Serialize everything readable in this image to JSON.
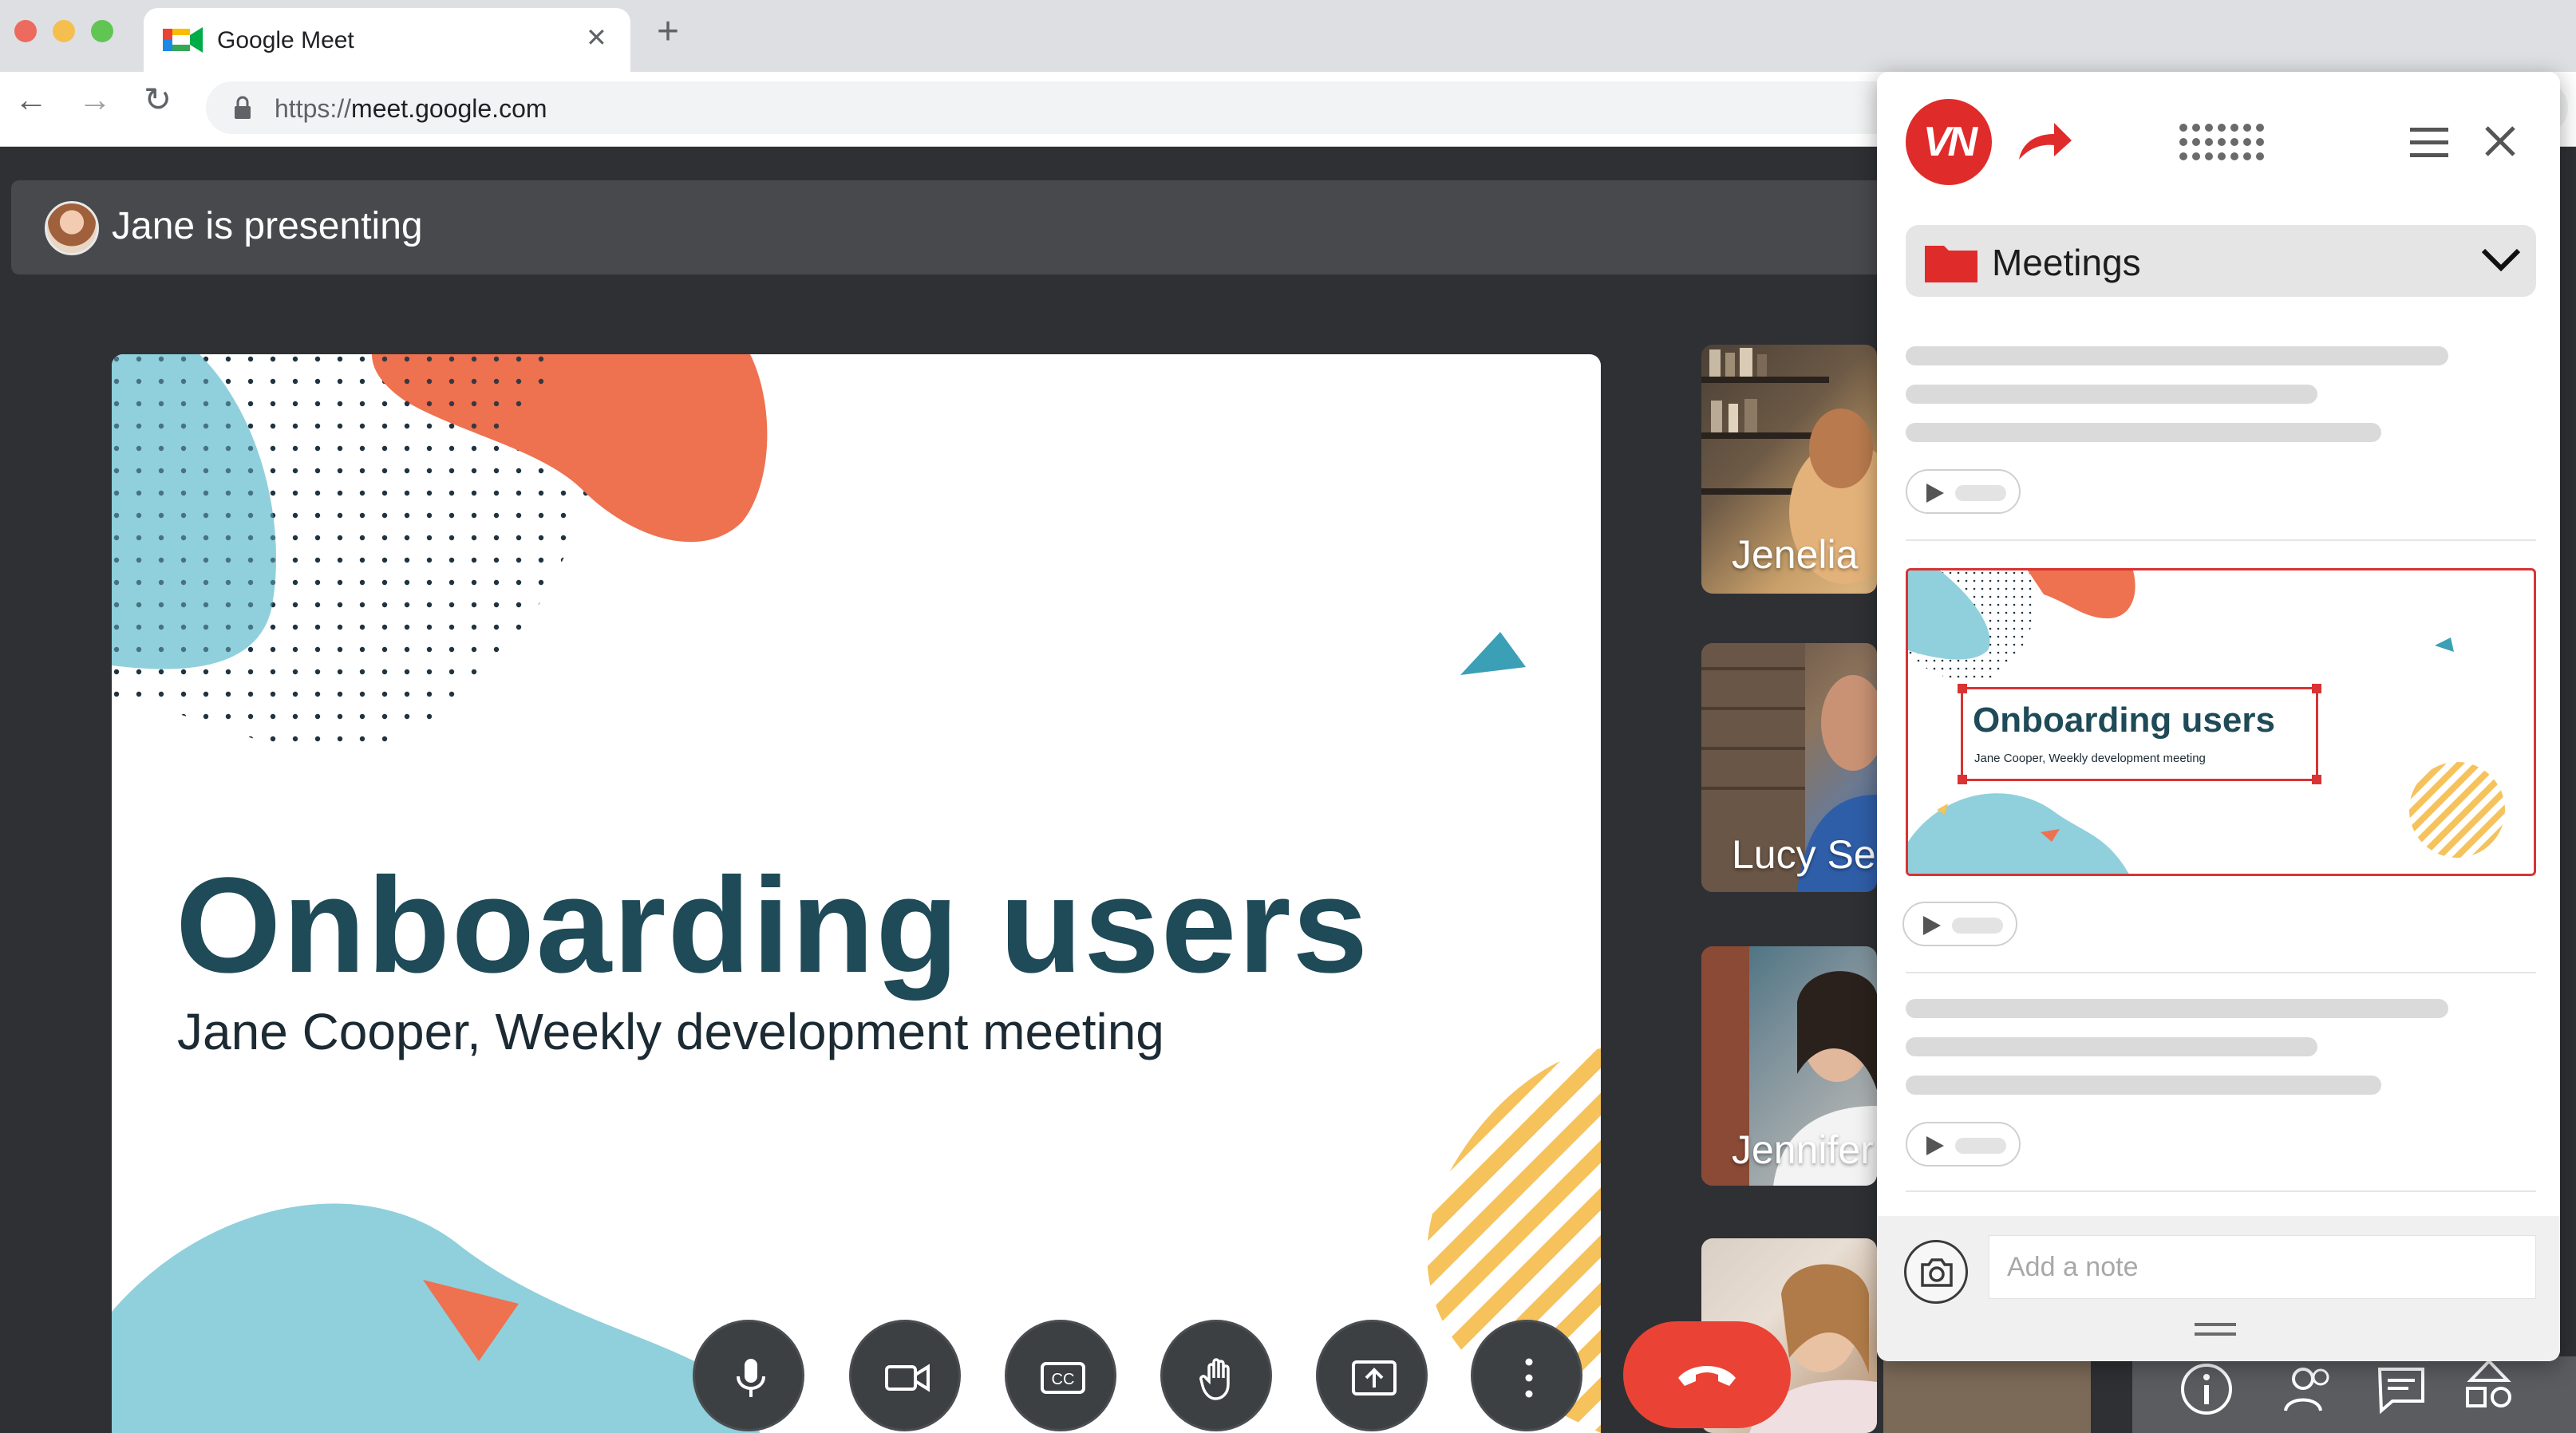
{
  "browser": {
    "tab_title": "Google Meet",
    "tab_close": "✕",
    "new_tab": "+",
    "url_scheme": "https://",
    "url_host": "meet.google.com",
    "back": "←",
    "forward": "→",
    "reload": "↻"
  },
  "meet": {
    "presenting_text": "Jane is presenting",
    "slide_title": "Onboarding users",
    "slide_subtitle": "Jane Cooper, Weekly development meeting",
    "participants": [
      {
        "name": "Jenelia"
      },
      {
        "name": "Lucy Se"
      },
      {
        "name": "Jennifer"
      },
      {
        "name": ""
      }
    ],
    "controls": [
      "mic-icon",
      "camera-icon",
      "captions-icon",
      "raise-hand-icon",
      "present-icon",
      "more-options-icon",
      "end-call-icon"
    ]
  },
  "panel": {
    "logo_text": "VN",
    "folder_label": "Meetings",
    "thumbnail_title": "Onboarding users",
    "thumbnail_subtitle": "Jane Cooper, Weekly development meeting",
    "note_placeholder": "Add a note"
  },
  "colors": {
    "accent_red": "#e02b2b",
    "slide_title": "#1f4a57",
    "meet_bg": "#2f3033",
    "end_call": "#ea4335"
  }
}
